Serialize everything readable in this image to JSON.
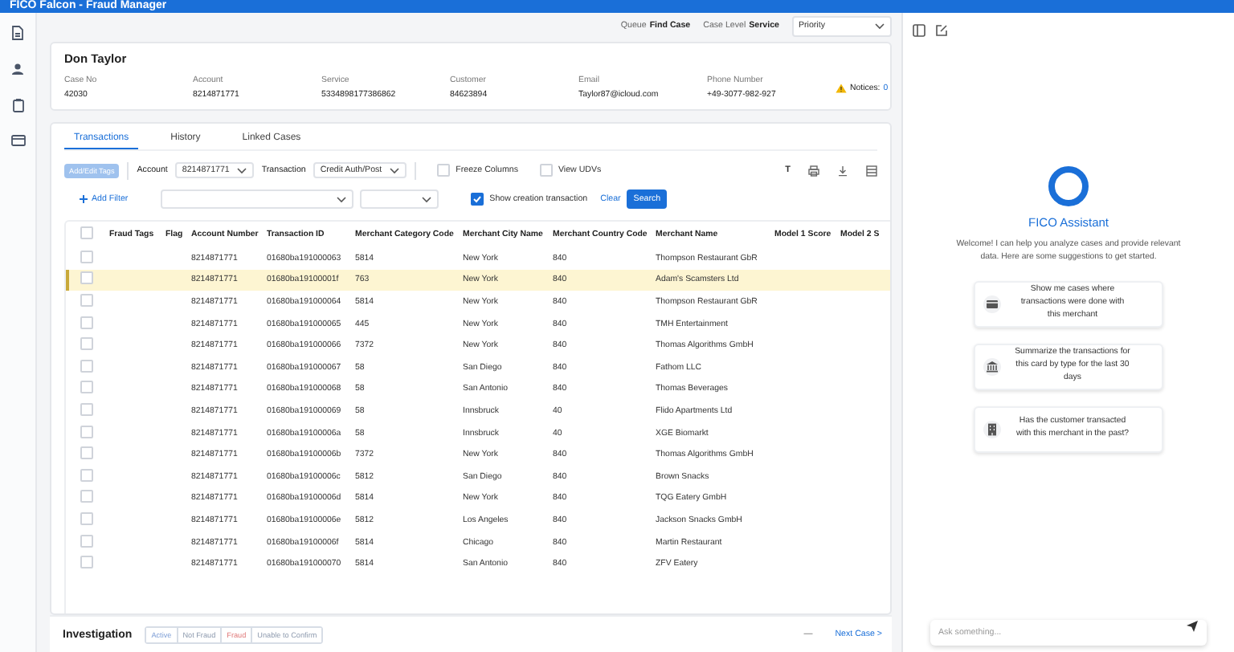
{
  "app": {
    "title": "FICO Falcon - Fraud Manager"
  },
  "case_bar": {
    "queue_label": "Queue",
    "queue": "Find Case",
    "level_label": "Case Level",
    "level": "Service",
    "priority": "Priority"
  },
  "case": {
    "name": "Don Taylor",
    "fields": [
      {
        "label": "Case No",
        "value": "42030"
      },
      {
        "label": "Account",
        "value": "8214871771"
      },
      {
        "label": "Service",
        "value": "5334898177386862"
      },
      {
        "label": "Customer",
        "value": "84623894"
      },
      {
        "label": "Email",
        "value": "Taylor87@icloud.com"
      },
      {
        "label": "Phone Number",
        "value": "+49-3077-982-927"
      }
    ],
    "notices_label": "Notices:",
    "notices_count": "0"
  },
  "tabs": [
    {
      "label": "Transactions",
      "selected": true
    },
    {
      "label": "History",
      "selected": false
    },
    {
      "label": "Linked Cases",
      "selected": false
    }
  ],
  "toolbar": {
    "tags_button": {
      "label": "Add/Edit Tags",
      "disabled": true
    },
    "account_label": "Account",
    "account": "8214871771",
    "transaction_label": "Transaction",
    "transaction": "Credit Auth/Post",
    "options": [
      {
        "label": "Freeze Columns",
        "checked": false
      },
      {
        "label": "View UDVs",
        "checked": false
      }
    ],
    "text_tool": "T"
  },
  "filter": {
    "add_filter": "Add Filter",
    "show_creation": {
      "label": "Show creation transaction",
      "checked": true
    },
    "clear": "Clear",
    "search": "Search"
  },
  "table": {
    "select_all_checked": false,
    "columns": [
      "Fraud Tags",
      "Flag",
      "Account Number",
      "Transaction ID",
      "Merchant Category Code",
      "Merchant City Name",
      "Merchant Country Code",
      "Merchant Name",
      "Model 1 Score",
      "Model 2 S"
    ],
    "rows": [
      {
        "selected": false,
        "checked": false,
        "cells": [
          "",
          "",
          "8214871771",
          "01680ba191000063",
          "5814",
          "New York",
          "840",
          "Thompson Restaurant GbR"
        ]
      },
      {
        "selected": true,
        "checked": false,
        "cells": [
          "",
          "",
          "8214871771",
          "01680ba19100001f",
          "763",
          "New York",
          "840",
          "Adam's Scamsters Ltd"
        ]
      },
      {
        "selected": false,
        "checked": false,
        "cells": [
          "",
          "",
          "8214871771",
          "01680ba191000064",
          "5814",
          "New York",
          "840",
          "Thompson Restaurant GbR"
        ]
      },
      {
        "selected": false,
        "checked": false,
        "cells": [
          "",
          "",
          "8214871771",
          "01680ba191000065",
          "445",
          "New York",
          "840",
          "TMH Entertainment"
        ]
      },
      {
        "selected": false,
        "checked": false,
        "cells": [
          "",
          "",
          "8214871771",
          "01680ba191000066",
          "7372",
          "New York",
          "840",
          "Thomas Algorithms GmbH"
        ]
      },
      {
        "selected": false,
        "checked": false,
        "cells": [
          "",
          "",
          "8214871771",
          "01680ba191000067",
          "58",
          "San Diego",
          "840",
          "Fathom LLC"
        ]
      },
      {
        "selected": false,
        "checked": false,
        "cells": [
          "",
          "",
          "8214871771",
          "01680ba191000068",
          "58",
          "San Antonio",
          "840",
          "Thomas Beverages"
        ]
      },
      {
        "selected": false,
        "checked": false,
        "cells": [
          "",
          "",
          "8214871771",
          "01680ba191000069",
          "58",
          "Innsbruck",
          "40",
          "Flido Apartments Ltd"
        ]
      },
      {
        "selected": false,
        "checked": false,
        "cells": [
          "",
          "",
          "8214871771",
          "01680ba19100006a",
          "58",
          "Innsbruck",
          "40",
          "XGE Biomarkt"
        ]
      },
      {
        "selected": false,
        "checked": false,
        "cells": [
          "",
          "",
          "8214871771",
          "01680ba19100006b",
          "7372",
          "New York",
          "840",
          "Thomas Algorithms GmbH"
        ]
      },
      {
        "selected": false,
        "checked": false,
        "cells": [
          "",
          "",
          "8214871771",
          "01680ba19100006c",
          "5812",
          "San Diego",
          "840",
          "Brown Snacks"
        ]
      },
      {
        "selected": false,
        "checked": false,
        "cells": [
          "",
          "",
          "8214871771",
          "01680ba19100006d",
          "5814",
          "New York",
          "840",
          "TQG Eatery GmbH"
        ]
      },
      {
        "selected": false,
        "checked": false,
        "cells": [
          "",
          "",
          "8214871771",
          "01680ba19100006e",
          "5812",
          "Los Angeles",
          "840",
          "Jackson Snacks GmbH"
        ]
      },
      {
        "selected": false,
        "checked": false,
        "cells": [
          "",
          "",
          "8214871771",
          "01680ba19100006f",
          "5814",
          "Chicago",
          "840",
          "Martin Restaurant"
        ]
      },
      {
        "selected": false,
        "checked": false,
        "cells": [
          "",
          "",
          "8214871771",
          "01680ba191000070",
          "5814",
          "San Antonio",
          "840",
          "ZFV Eatery"
        ]
      }
    ]
  },
  "investigation": {
    "title": "Investigation",
    "statuses": [
      {
        "label": "Active",
        "kind": "active"
      },
      {
        "label": "Not Fraud",
        "kind": "neutral"
      },
      {
        "label": "Fraud",
        "kind": "fraud"
      },
      {
        "label": "Unable to Confirm",
        "kind": "neutral"
      }
    ],
    "dash": "—",
    "next": "Next Case >"
  },
  "assistant": {
    "title": "FICO Assistant",
    "welcome": "Welcome! I can help you analyze cases and provide relevant data. Here are some suggestions to get started.",
    "suggestions": [
      {
        "kind": "card",
        "text": "Show me cases where transactions were done with this merchant"
      },
      {
        "kind": "bank",
        "text": "Summarize the transactions for this card by type for the last 30 days"
      },
      {
        "kind": "building",
        "text": "Has the customer transacted with this merchant in the past?"
      }
    ],
    "input": {
      "placeholder": "Ask something..."
    }
  }
}
